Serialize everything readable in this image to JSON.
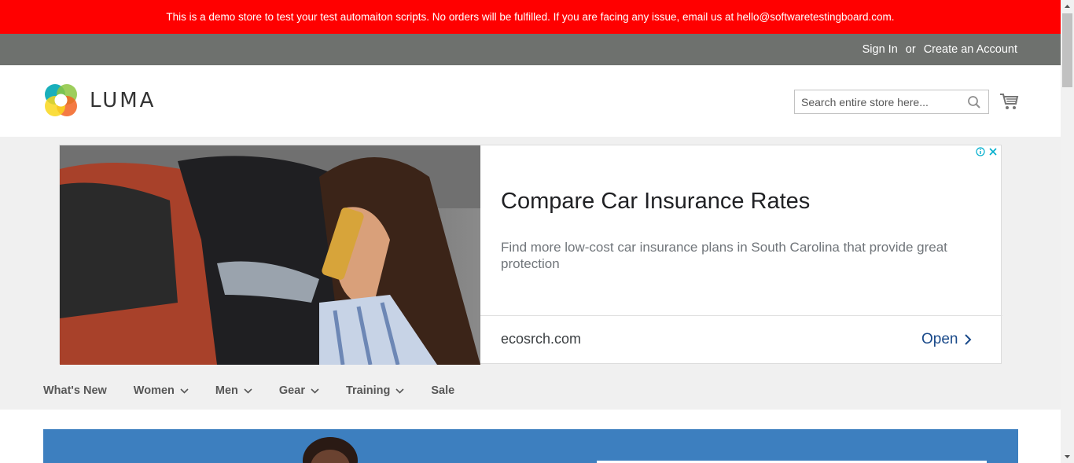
{
  "demo_notice": "This is a demo store to test your test automaiton scripts. No orders will be fulfilled. If you are facing any issue, email us at hello@softwaretestingboard.com.",
  "header_links": {
    "sign_in": "Sign In",
    "or": "or",
    "create_account": "Create an Account"
  },
  "logo": {
    "text": "LUMA",
    "icon": "luma-logo-icon"
  },
  "search": {
    "placeholder": "Search entire store here...",
    "value": ""
  },
  "ad": {
    "headline": "Compare Car Insurance Rates",
    "description": "Find more low-cost car insurance plans in South Carolina that provide great protection",
    "domain": "ecosrch.com",
    "cta": "Open"
  },
  "nav": {
    "items": [
      {
        "label": "What's New",
        "has_dropdown": false
      },
      {
        "label": "Women",
        "has_dropdown": true
      },
      {
        "label": "Men",
        "has_dropdown": true
      },
      {
        "label": "Gear",
        "has_dropdown": true
      },
      {
        "label": "Training",
        "has_dropdown": true
      },
      {
        "label": "Sale",
        "has_dropdown": false
      }
    ]
  },
  "colors": {
    "demo_banner_bg": "#ff0000",
    "panel_header_bg": "#6e716e",
    "nav_bg": "#f0f0f0",
    "ad_cta": "#1a4a8a"
  }
}
